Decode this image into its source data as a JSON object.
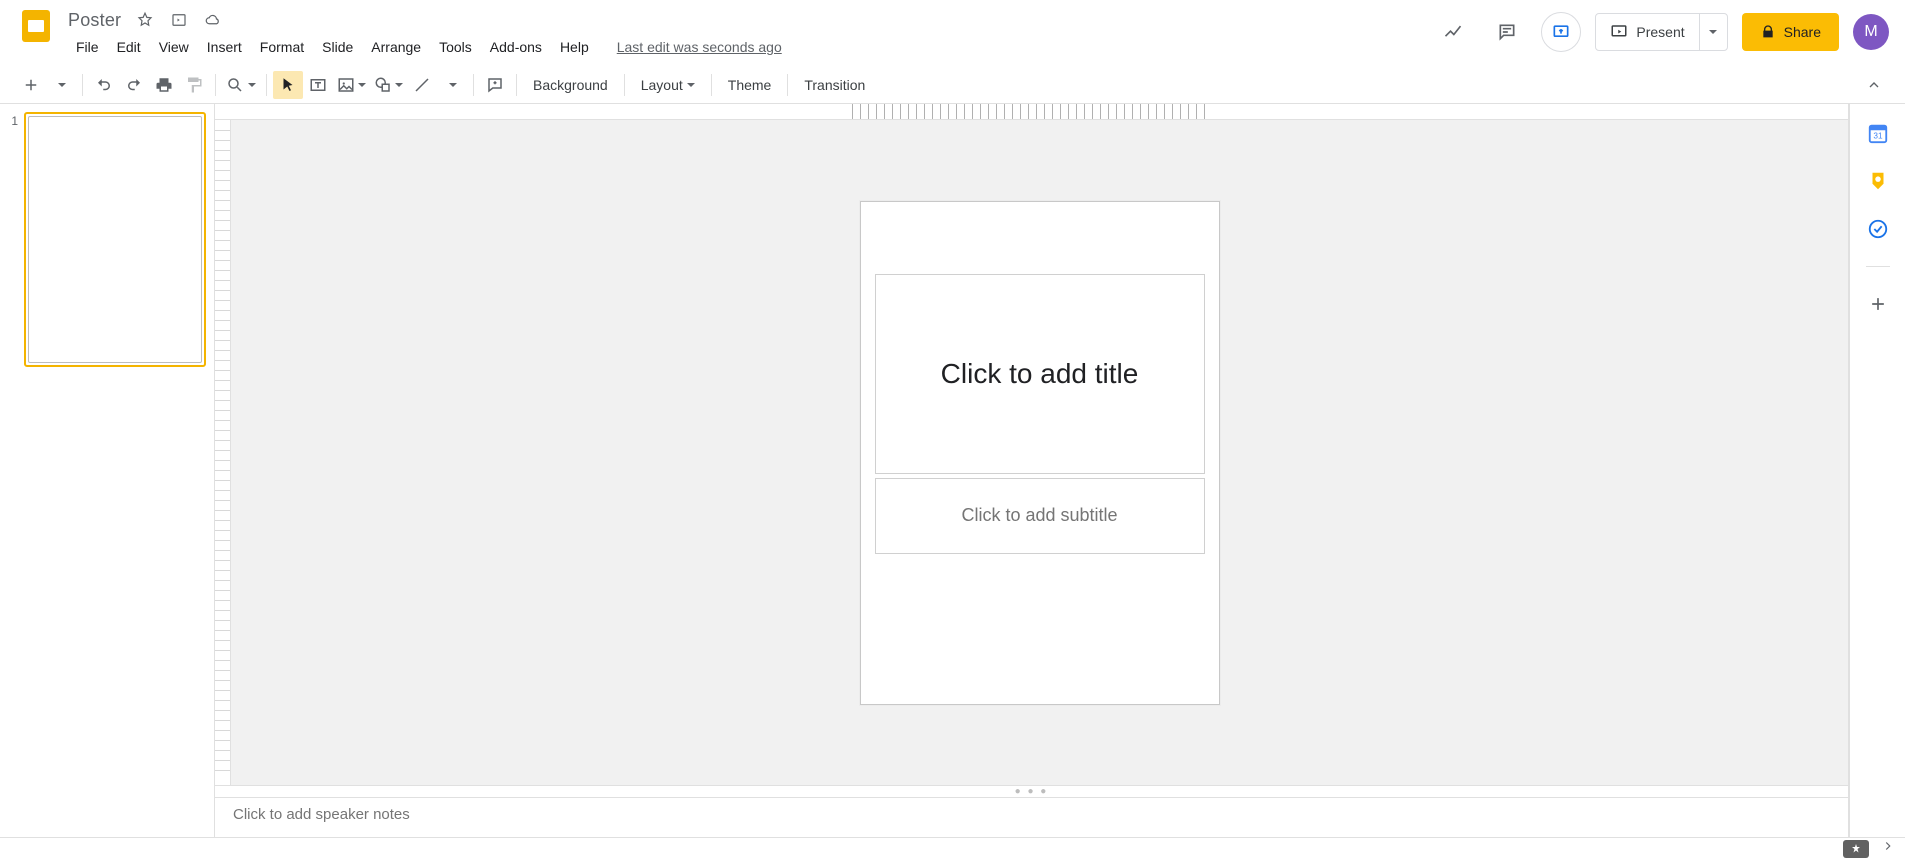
{
  "doc": {
    "name": "Poster",
    "last_edit": "Last edit was seconds ago"
  },
  "menu": {
    "file": "File",
    "edit": "Edit",
    "view": "View",
    "insert": "Insert",
    "format": "Format",
    "slide": "Slide",
    "arrange": "Arrange",
    "tools": "Tools",
    "addons": "Add-ons",
    "help": "Help"
  },
  "actions": {
    "present": "Present",
    "share": "Share",
    "avatar_initial": "M"
  },
  "toolbar": {
    "background": "Background",
    "layout": "Layout",
    "theme": "Theme",
    "transition": "Transition"
  },
  "filmstrip": {
    "slides": [
      {
        "num": "1"
      }
    ]
  },
  "canvas": {
    "title_placeholder": "Click to add title",
    "subtitle_placeholder": "Click to add subtitle"
  },
  "notes": {
    "placeholder": "Click to add speaker notes"
  }
}
